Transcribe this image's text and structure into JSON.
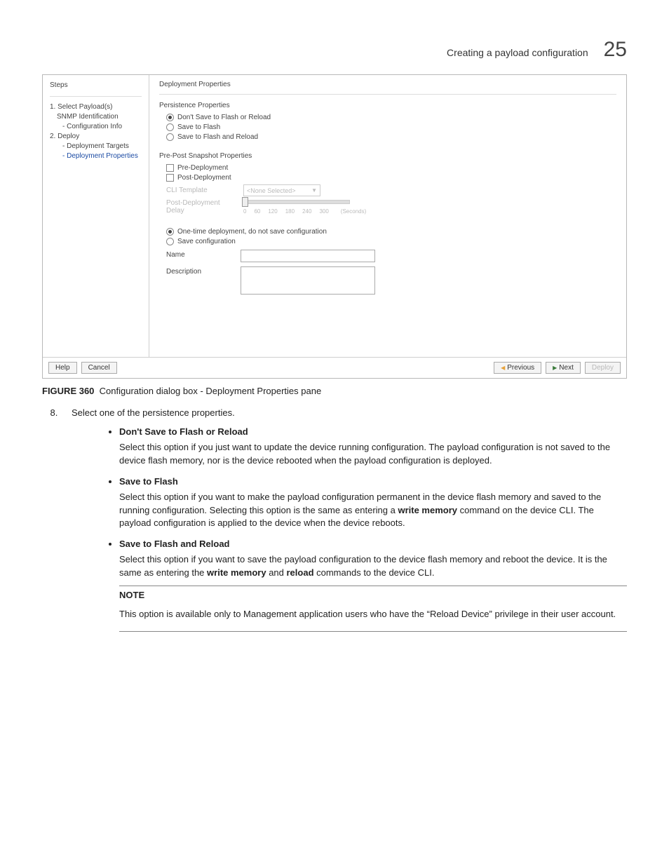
{
  "header": {
    "title": "Creating a payload configuration",
    "number": "25"
  },
  "dialog": {
    "steps_label": "Steps",
    "steps": [
      {
        "text": "1. Select Payload(s)",
        "cls": ""
      },
      {
        "text": "SNMP Identification",
        "cls": "ind1"
      },
      {
        "text": "- Configuration Info",
        "cls": "ind2"
      },
      {
        "text": "2. Deploy",
        "cls": ""
      },
      {
        "text": "- Deployment Targets",
        "cls": "ind2"
      },
      {
        "text": "- Deployment Properties",
        "cls": "ind2 active"
      }
    ],
    "main_title": "Deployment Properties",
    "persist_title": "Persistence Properties",
    "persist_opts": {
      "o1": "Don't Save to Flash or Reload",
      "o2": "Save to Flash",
      "o3": "Save to Flash and Reload"
    },
    "snapshot_title": "Pre-Post Snapshot Properties",
    "chk1": "Pre-Deployment",
    "chk2": "Post-Deployment",
    "cli_label": "CLI Template",
    "cli_value": "<None Selected>",
    "delay_label": "Post-Deployment Delay",
    "ticks": [
      "0",
      "60",
      "120",
      "180",
      "240",
      "300"
    ],
    "ticks_unit": "(Seconds)",
    "deploy_o1": "One-time deployment, do not save configuration",
    "deploy_o2": "Save configuration",
    "name_label": "Name",
    "desc_label": "Description",
    "buttons": {
      "help": "Help",
      "cancel": "Cancel",
      "prev": "Previous",
      "next": "Next",
      "deploy": "Deploy"
    }
  },
  "fig": {
    "label": "FIGURE 360",
    "text": "Configuration dialog box - Deployment Properties pane"
  },
  "body": {
    "step8": "Select one of the persistence properties.",
    "b1_title": "Don't Save to Flash or Reload",
    "b1_text": "Select this option if you just want to update the device running configuration. The payload configuration is not saved to the device flash memory, nor is the device rebooted when the payload configuration is deployed.",
    "b2_title": "Save to Flash",
    "b2_text1": "Select this option if you want to make the payload configuration permanent in the device flash memory and saved to the running configuration. Selecting this option is the same as entering a ",
    "b2_bold": "write memory",
    "b2_text2": " command on the device CLI. The payload configuration is applied to the device when the device reboots.",
    "b3_title": "Save to Flash and Reload",
    "b3_text1": "Select this option if you want to save the payload configuration to the device flash memory and reboot the device. It is the same as entering the ",
    "b3_bold1": "write memory",
    "b3_mid": " and ",
    "b3_bold2": "reload",
    "b3_text2": " commands to the device CLI.",
    "note_label": "NOTE",
    "note_text": "This option is available only to Management application users who have the “Reload Device” privilege in their user account."
  }
}
